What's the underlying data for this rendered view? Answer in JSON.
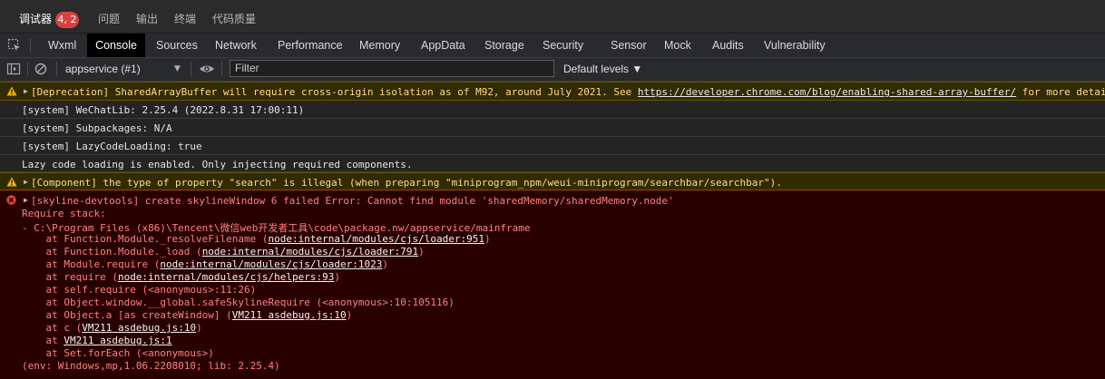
{
  "top_tabs": [
    {
      "label": "调试器"
    },
    {
      "label": "问题"
    },
    {
      "label": "输出"
    },
    {
      "label": "终端"
    },
    {
      "label": "代码质量"
    }
  ],
  "issue_badge": "4, 2",
  "devtools_tabs": [
    "Wxml",
    "Console",
    "Sources",
    "Network",
    "Performance",
    "Memory",
    "AppData",
    "Storage",
    "Security",
    "Sensor",
    "Mock",
    "Audits",
    "Vulnerability"
  ],
  "active_tab": "Console",
  "toolbar": {
    "context": "appservice (#1)",
    "filter_placeholder": "Filter",
    "levels": "Default levels ▼"
  },
  "messages": {
    "m1": {
      "text": "[Deprecation] SharedArrayBuffer will require cross-origin isolation as of M92, around July 2021. See ",
      "link": "https://developer.chrome.com/blog/enabling-shared-array-buffer/",
      "suffix": " for more details."
    },
    "m2": "[system] WeChatLib: 2.25.4 (2022.8.31 17:00:11)",
    "m3": "[system] Subpackages: N/A",
    "m4": "[system] LazyCodeLoading: true",
    "m5": "Lazy code loading is enabled. Only injecting required components.",
    "m6": "[Component] the type of property \"search\" is illegal (when preparing \"miniprogram_npm/weui-miniprogram/searchbar/searchbar\").",
    "m7": {
      "head": "[skyline-devtools] create skylineWindow 6 failed Error: Cannot find module 'sharedMemory/sharedMemory.node'",
      "l1": "Require stack:",
      "l2": "- C:\\Program Files (x86)\\Tencent\\微信web开发者工具\\code\\package.nw/appservice/mainframe",
      "s1a": "    at Function.Module._resolveFilename (",
      "s1b": "node:internal/modules/cjs/loader:951",
      "s1c": ")",
      "s2a": "    at Function.Module._load (",
      "s2b": "node:internal/modules/cjs/loader:791",
      "s2c": ")",
      "s3a": "    at Module.require (",
      "s3b": "node:internal/modules/cjs/loader:1023",
      "s3c": ")",
      "s4a": "    at require (",
      "s4b": "node:internal/modules/cjs/helpers:93",
      "s4c": ")",
      "s5": "    at self.require (<anonymous>:11:26)",
      "s6": "    at Object.window.__global.safeSkylineRequire (<anonymous>:10:105116)",
      "s7a": "    at Object.a [as createWindow] (",
      "s7b": "VM211 asdebug.js:10",
      "s7c": ")",
      "s8a": "    at c (",
      "s8b": "VM211 asdebug.js:10",
      "s8c": ")",
      "s9a": "    at ",
      "s9b": "VM211 asdebug.js:1",
      "s10": "    at Set.forEach (<anonymous>)",
      "env": "(env: Windows,mp,1.06.2208010; lib: 2.25.4)"
    }
  },
  "colors": {
    "warning": "#f3b300",
    "error": "#e0403c",
    "active_tab_bg": "#000000",
    "badge": "#d9413f"
  }
}
